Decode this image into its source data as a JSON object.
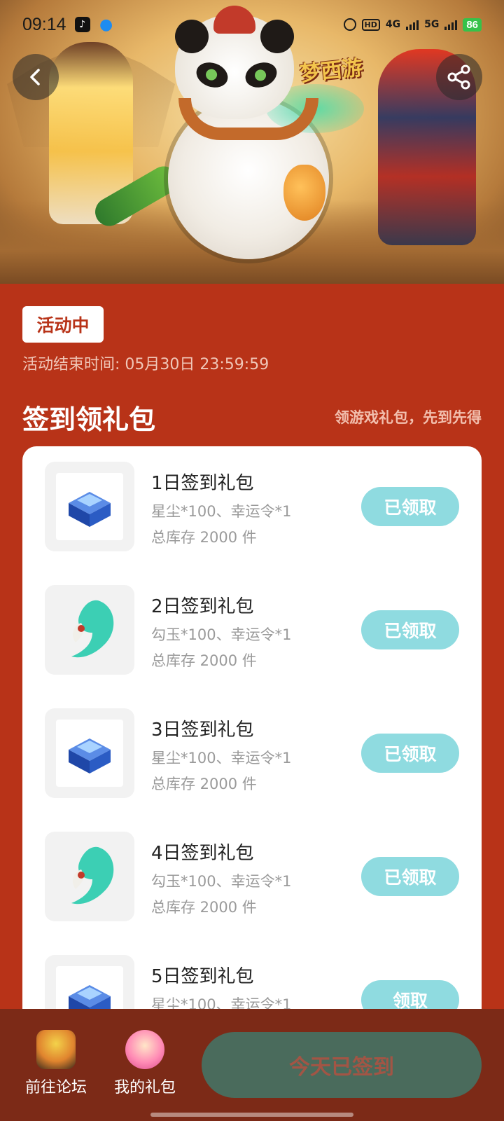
{
  "status_bar": {
    "time": "09:14",
    "hd_label": "HD",
    "network_1": "4G",
    "network_2": "5G",
    "battery": "86"
  },
  "hero": {
    "game_logo_text": "梦西游"
  },
  "activity": {
    "status_tag": "活动中",
    "end_time": "活动结束时间: 05月30日 23:59:59"
  },
  "section": {
    "title": "签到领礼包",
    "subtitle": "领游戏礼包，先到先得"
  },
  "gifts": [
    {
      "name": "1日签到礼包",
      "items": "星尘*100、幸运令*1",
      "stock": "总库存 2000 件",
      "button": "已领取",
      "icon": "blue-chest-icon"
    },
    {
      "name": "2日签到礼包",
      "items": "勾玉*100、幸运令*1",
      "stock": "总库存 2000 件",
      "button": "已领取",
      "icon": "jade-magatama-icon"
    },
    {
      "name": "3日签到礼包",
      "items": "星尘*100、幸运令*1",
      "stock": "总库存 2000 件",
      "button": "已领取",
      "icon": "blue-chest-icon"
    },
    {
      "name": "4日签到礼包",
      "items": "勾玉*100、幸运令*1",
      "stock": "总库存 2000 件",
      "button": "已领取",
      "icon": "jade-magatama-icon"
    },
    {
      "name": "5日签到礼包",
      "items": "星尘*100、幸运令*1",
      "stock": "",
      "button": "领取",
      "icon": "blue-chest-icon"
    }
  ],
  "bottom_bar": {
    "forum_label": "前往论坛",
    "my_gifts_label": "我的礼包",
    "signin_button": "今天已签到"
  },
  "colors": {
    "page_background": "#b83318",
    "claim_button": "#8fdbe0",
    "bottom_bar": "#7c2a17",
    "signin_button": "#4a6b5c"
  }
}
